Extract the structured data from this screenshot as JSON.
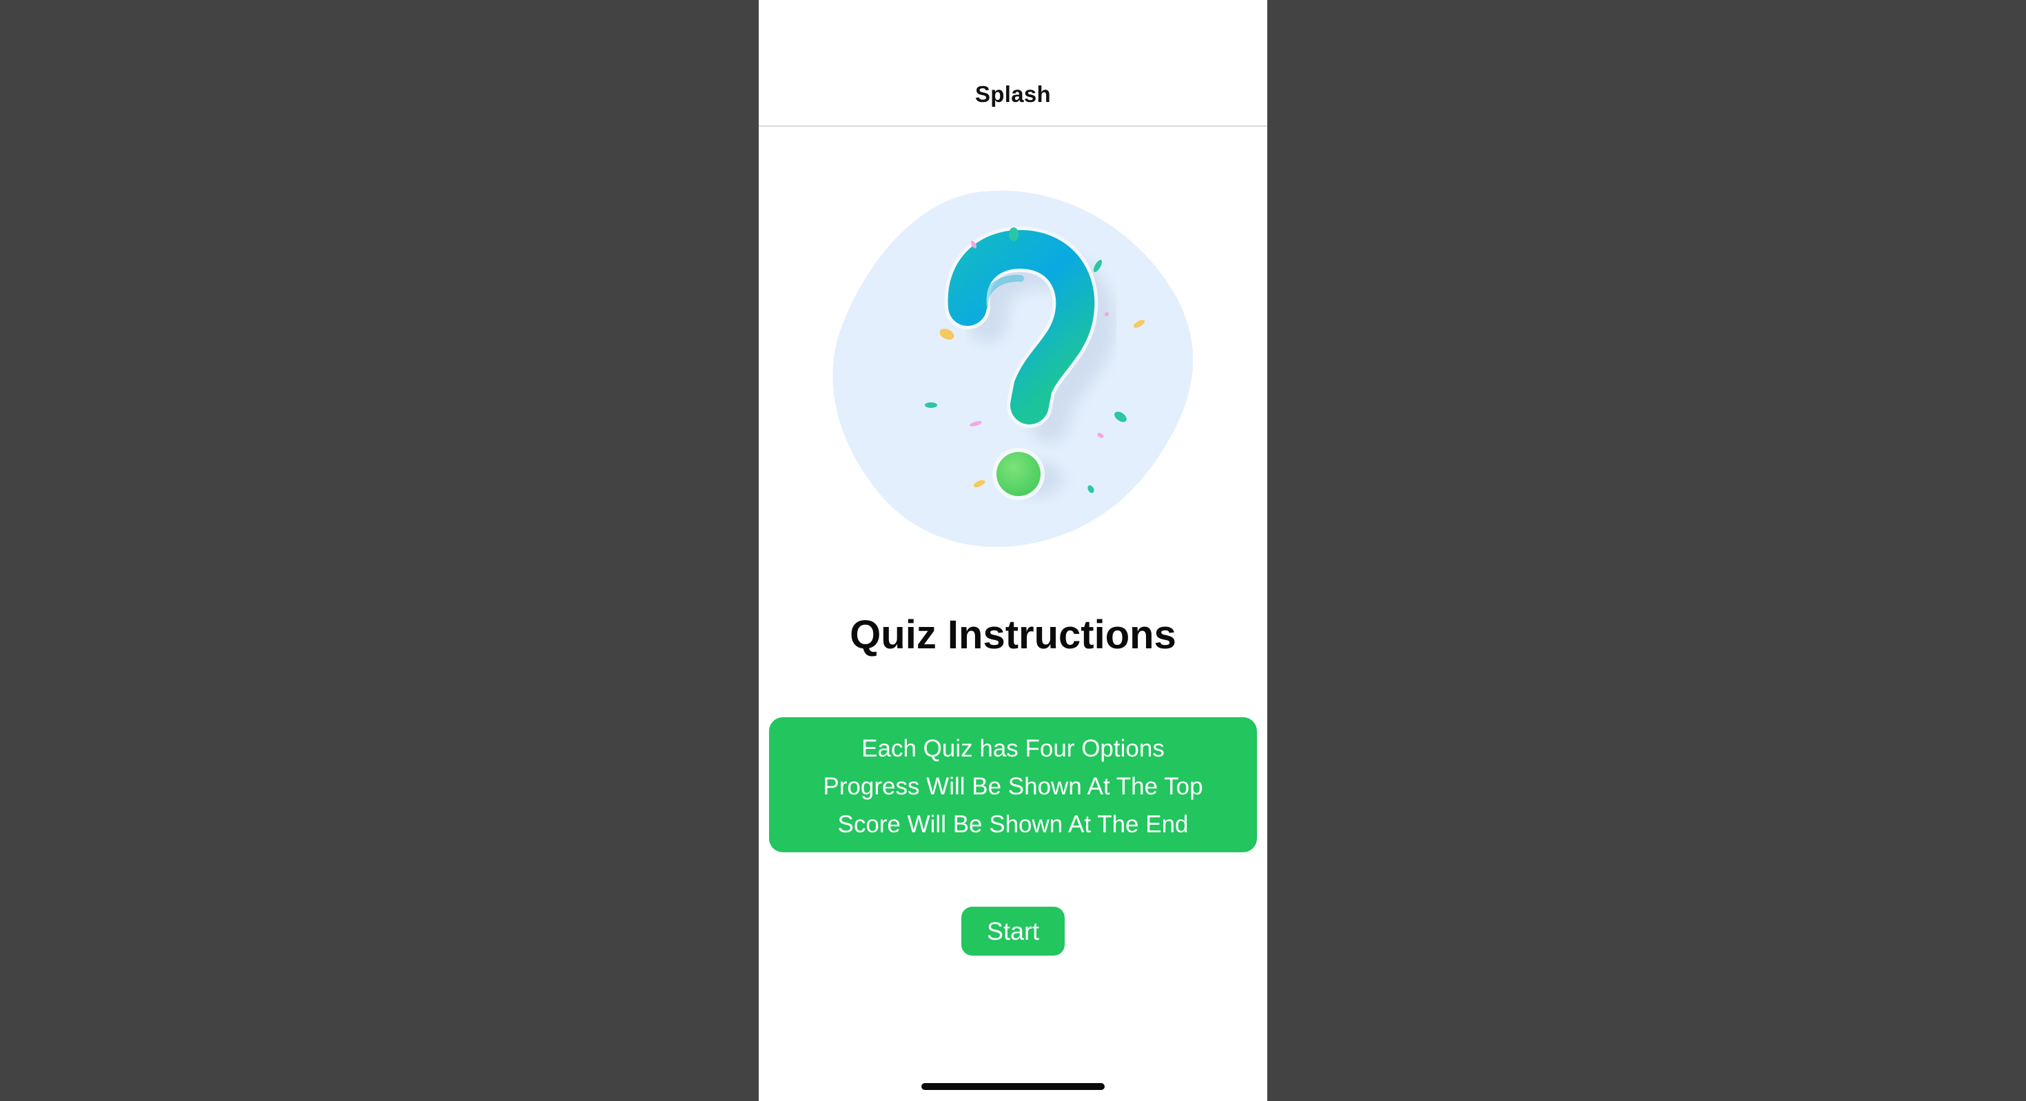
{
  "nav": {
    "title": "Splash"
  },
  "hero": {
    "icon": "question-mark-illustration"
  },
  "instructions": {
    "heading": "Quiz Instructions",
    "lines": [
      "Each Quiz has Four Options",
      "Progress Will Be Shown At The Top",
      "Score Will Be Shown At The End"
    ]
  },
  "actions": {
    "start_label": "Start"
  },
  "colors": {
    "accent": "#22c55e",
    "background": "#434343",
    "blob": "#e3effc"
  }
}
